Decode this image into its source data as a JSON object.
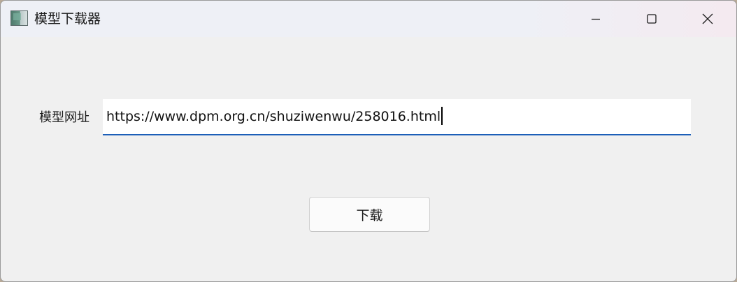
{
  "window": {
    "title": "模型下载器",
    "controls": {
      "minimize": "minimize-icon",
      "maximize": "maximize-icon",
      "close": "close-icon"
    }
  },
  "form": {
    "url_label": "模型网址",
    "url_value": "https://www.dpm.org.cn/shuziwenwu/258016.html",
    "download_label": "下载"
  },
  "colors": {
    "accent": "#1c5fb8",
    "window_bg": "#f0f0f0",
    "titlebar_bg": "#eef0f6"
  }
}
